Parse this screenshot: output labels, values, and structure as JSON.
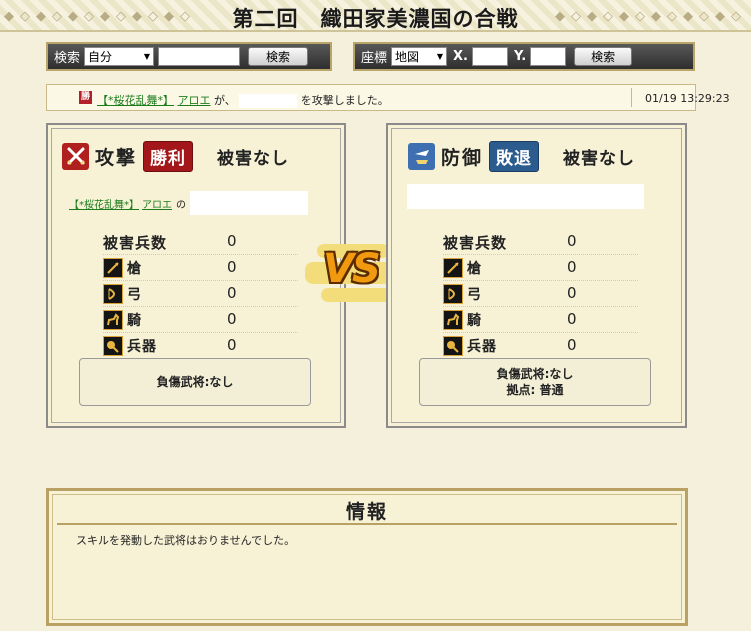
{
  "title": "第二回　織田家美濃国の合戦",
  "title_decor": "◆◇◆◇◆◇◆◇◆◇◆◇",
  "search": {
    "label": "検索",
    "select_value": "自分",
    "button": "検索"
  },
  "coord": {
    "label": "座標",
    "select_value": "地図",
    "x_label": "X.",
    "y_label": "Y.",
    "button": "検索"
  },
  "log": {
    "badge": "勝",
    "alliance": "【*桜花乱舞*】",
    "player": "アロエ",
    "particle_ga": "が、",
    "suffix": "を攻撃しました。",
    "timestamp": "01/19 13:29:23"
  },
  "attacker": {
    "word": "攻撃",
    "result": "勝利",
    "damage": "被害なし",
    "alliance": "【*桜花乱舞*】",
    "player": "アロエ",
    "particle_no": "の",
    "stats": [
      {
        "label": "被害兵数",
        "value": "0"
      },
      {
        "label": "槍",
        "value": "0",
        "icon": "spear-icon"
      },
      {
        "label": "弓",
        "value": "0",
        "icon": "bow-icon"
      },
      {
        "label": "騎",
        "value": "0",
        "icon": "horse-icon"
      },
      {
        "label": "兵器",
        "value": "0",
        "icon": "siege-weapon-icon"
      }
    ],
    "injury": "負傷武将:なし"
  },
  "defender": {
    "word": "防御",
    "result": "敗退",
    "damage": "被害なし",
    "stats": [
      {
        "label": "被害兵数",
        "value": "0"
      },
      {
        "label": "槍",
        "value": "0",
        "icon": "spear-icon"
      },
      {
        "label": "弓",
        "value": "0",
        "icon": "bow-icon"
      },
      {
        "label": "騎",
        "value": "0",
        "icon": "horse-icon"
      },
      {
        "label": "兵器",
        "value": "0",
        "icon": "siege-weapon-icon"
      }
    ],
    "injury": "負傷武将:なし",
    "base": "拠点: 普通"
  },
  "vs": "VS",
  "info": {
    "title": "情報",
    "message": "スキルを発動した武将はおりませんでした。"
  },
  "colors": {
    "win_red": "#a31619",
    "lose_blue": "#2c5c8e",
    "link_green": "#1c7c1c",
    "gold": "#b9a163"
  }
}
